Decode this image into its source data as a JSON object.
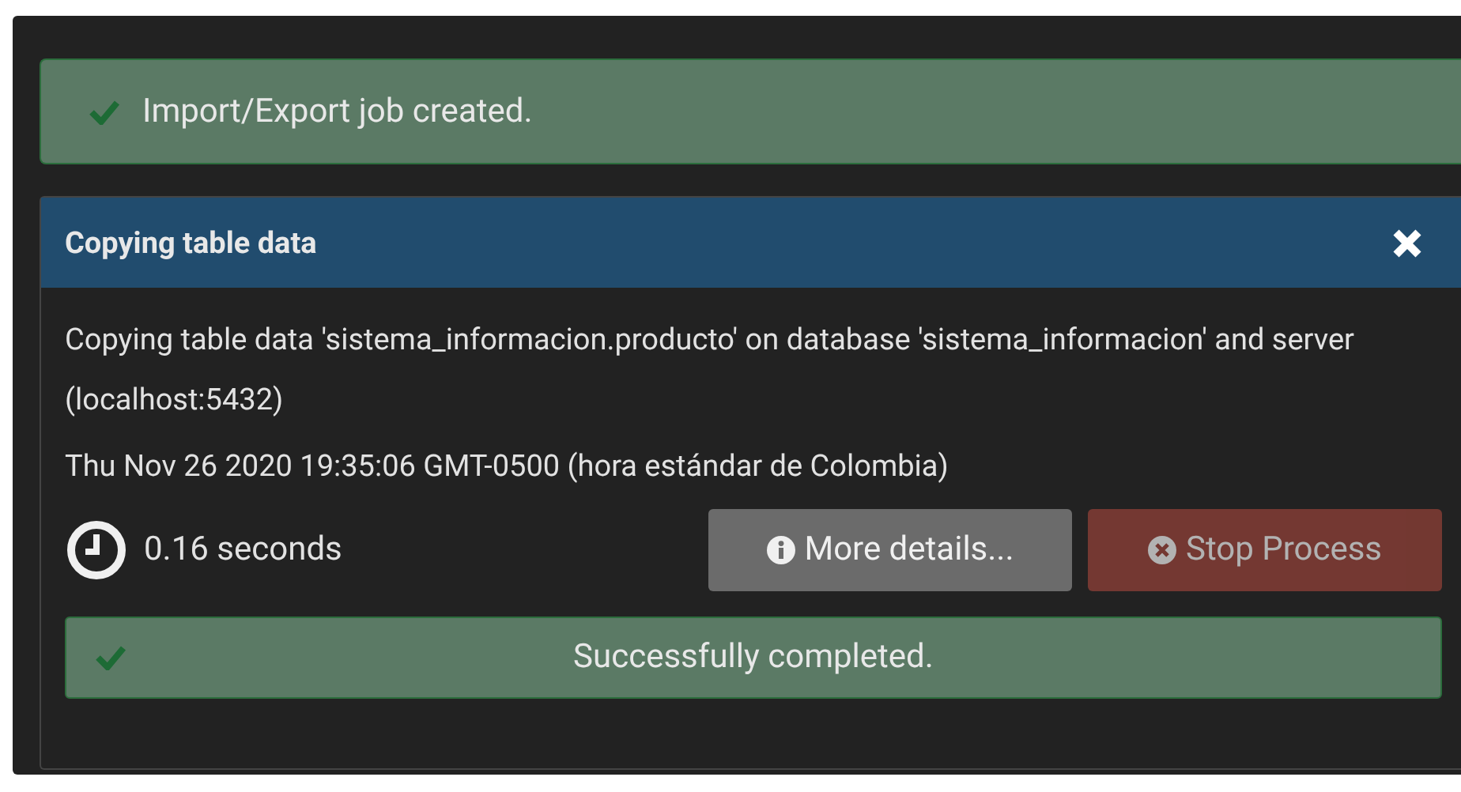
{
  "toast": {
    "message": "Import/Export job created."
  },
  "process": {
    "title": "Copying table data",
    "description": "Copying table data 'sistema_informacion.producto' on database 'sistema_informacion' and server (localhost:5432)",
    "timestamp": "Thu Nov 26 2020 19:35:06 GMT-0500 (hora estándar de Colombia)",
    "elapsed": "0.16 seconds",
    "buttons": [
      {
        "kind": "details",
        "label": "More details...",
        "disabled": false
      },
      {
        "kind": "stop",
        "label": "Stop Process",
        "disabled": true
      }
    ],
    "status": "Successfully completed."
  }
}
